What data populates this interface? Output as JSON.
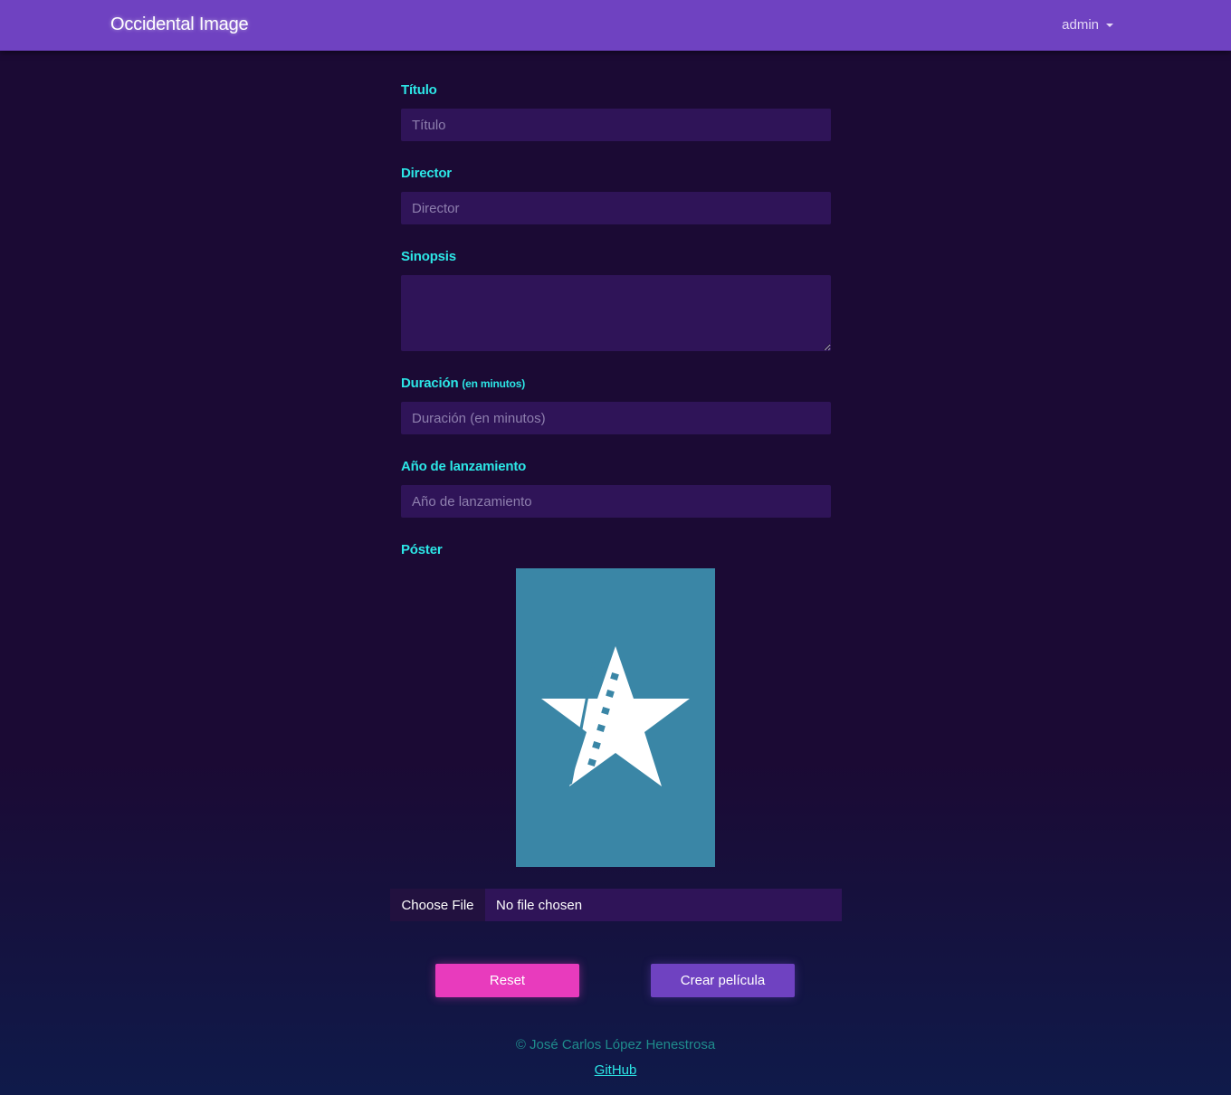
{
  "navbar": {
    "brand": "Occidental Image",
    "user": "admin"
  },
  "form": {
    "titulo": {
      "label": "Título",
      "placeholder": "Título"
    },
    "director": {
      "label": "Director",
      "placeholder": "Director"
    },
    "sinopsis": {
      "label": "Sinopsis"
    },
    "duracion": {
      "label": "Duración",
      "label_small": "(en minutos)",
      "placeholder": "Duración (en minutos)"
    },
    "anio": {
      "label": "Año de lanzamiento",
      "placeholder": "Año de lanzamiento"
    },
    "poster": {
      "label": "Póster",
      "icon": "film-star-icon",
      "bg_color": "#3a86a6"
    },
    "file": {
      "button": "Choose File",
      "status": "No file chosen"
    }
  },
  "buttons": {
    "reset": "Reset",
    "create": "Crear película"
  },
  "footer": {
    "copyright": "© José Carlos López Henestrosa",
    "github": "GitHub"
  },
  "colors": {
    "navbar": "#6f42c1",
    "label": "#2ce6e6",
    "input_bg": "#2f1458",
    "reset": "#e83bbd",
    "create": "#6f42c1"
  }
}
